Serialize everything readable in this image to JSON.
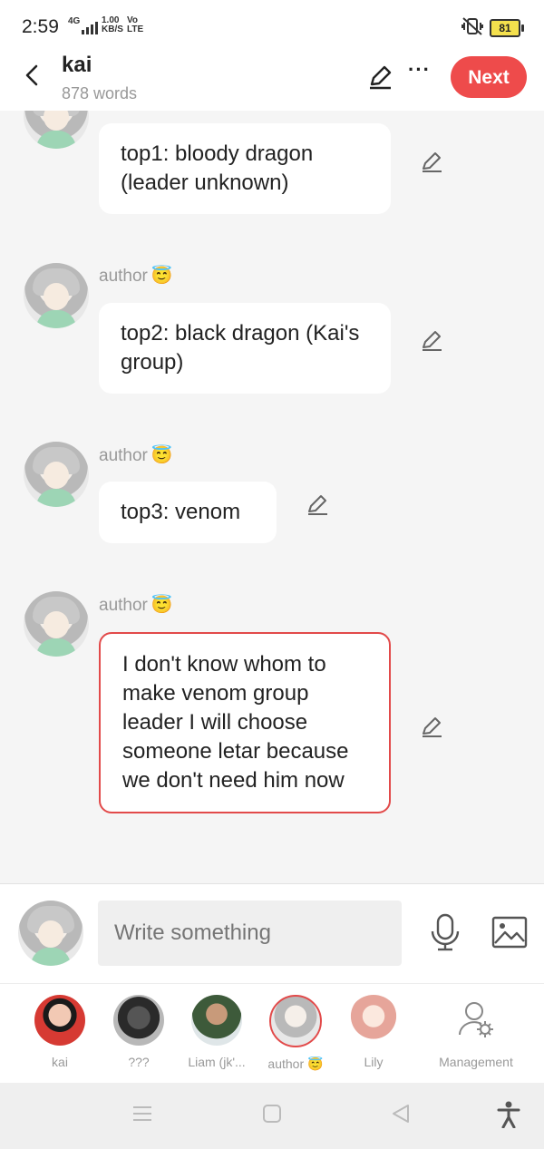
{
  "status_bar": {
    "time": "2:59",
    "network": "4G",
    "speed_value": "1.00",
    "speed_unit": "KB/S",
    "volte_top": "Vo",
    "volte_bottom": "LTE",
    "battery": "81"
  },
  "header": {
    "title": "kai",
    "word_count": "878 words",
    "next_label": "Next"
  },
  "messages": [
    {
      "author": "",
      "text": "top1: bloody dragon (leader unknown)"
    },
    {
      "author": "author",
      "text": "top2: black dragon (Kai's group)"
    },
    {
      "author": "author",
      "text": "top3: venom"
    },
    {
      "author": "author",
      "text": "I don't know whom to make venom group leader I will choose someone letar because we don't need him now"
    }
  ],
  "author_emoji": "😇",
  "composer": {
    "placeholder": "Write something"
  },
  "characters": [
    {
      "name": "kai"
    },
    {
      "name": "???"
    },
    {
      "name": "Liam (jk'..."
    },
    {
      "name": "author"
    },
    {
      "name": "Lily"
    },
    {
      "name": "Management"
    }
  ],
  "colors": {
    "accent": "#ee4b4b",
    "background": "#f5f5f5",
    "bubble": "#ffffff"
  },
  "icons": [
    "back-arrow-icon",
    "edit-pencil-icon",
    "more-icon",
    "microphone-icon",
    "image-icon",
    "settings-person-icon",
    "menu-icon",
    "home-icon",
    "back-icon",
    "accessibility-icon"
  ]
}
